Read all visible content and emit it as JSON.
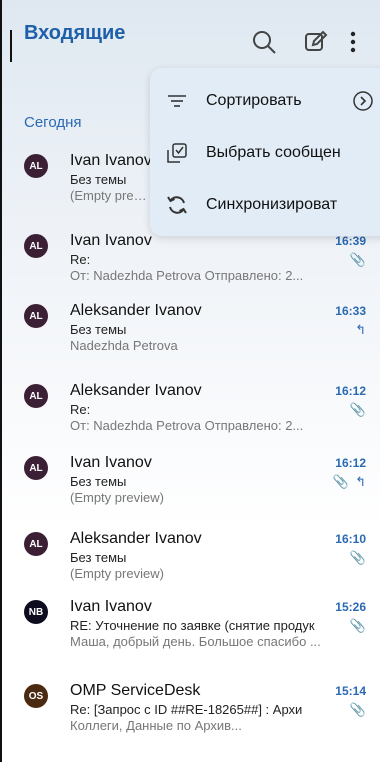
{
  "header": {
    "title": "Входящие",
    "icons": [
      "search-icon",
      "compose-icon",
      "more-icon"
    ]
  },
  "section": "Сегодня",
  "menu": [
    {
      "label": "Сортировать",
      "icon": "sort-icon",
      "has_chevron": true
    },
    {
      "label": "Выбрать сообщен",
      "icon": "select-icon",
      "has_chevron": false
    },
    {
      "label": "Синхронизироват",
      "icon": "sync-icon",
      "has_chevron": false
    }
  ],
  "messages": [
    {
      "avatar": "AL",
      "avatar_color": "#3a1f35",
      "sender": "Ivan Ivanov",
      "subject": "Без темы",
      "preview": "(Empty preview)",
      "time": "",
      "flags": []
    },
    {
      "avatar": "AL",
      "avatar_color": "#3a1f35",
      "sender": "Ivan Ivanov",
      "subject": "Re:",
      "preview": "От: Nadezhda Petrova Отправлено: 2...",
      "time": "16:39",
      "flags": [
        "attachment"
      ]
    },
    {
      "avatar": "AL",
      "avatar_color": "#3a1f35",
      "sender": "Aleksander Ivanov",
      "subject": "Без темы",
      "preview": "Nadezhda Petrova",
      "time": "16:33",
      "flags": [
        "reply"
      ]
    },
    {
      "avatar": "AL",
      "avatar_color": "#3a1f35",
      "sender": "Aleksander Ivanov",
      "subject": "Re:",
      "preview": "От: Nadezhda Petrova Отправлено: 2...",
      "time": "16:12",
      "flags": [
        "attachment"
      ]
    },
    {
      "avatar": "AL",
      "avatar_color": "#3a1f35",
      "sender": "Ivan Ivanov",
      "subject": "Без темы",
      "preview": "(Empty preview)",
      "time": "16:12",
      "flags": [
        "attachment",
        "reply"
      ]
    },
    {
      "avatar": "AL",
      "avatar_color": "#3a1f35",
      "sender": "Aleksander Ivanov",
      "subject": "Без темы",
      "preview": "(Empty preview)",
      "time": "16:10",
      "flags": [
        "attachment"
      ]
    },
    {
      "avatar": "NB",
      "avatar_color": "#0d0d1f",
      "sender": "Ivan Ivanov",
      "subject": "RE: Уточнение по заявке (снятие продук",
      "preview": "Маша, добрый день. Большое спасибо ...",
      "time": "15:26",
      "flags": [
        "attachment"
      ]
    },
    {
      "avatar": "OS",
      "avatar_color": "#4a2a10",
      "sender": "OMP ServiceDesk",
      "subject": "Re: [Запрос с ID ##RE-18265##] : Архи",
      "preview": "Коллеги, Данные по Архив...",
      "time": "15:14",
      "flags": [
        "attachment"
      ]
    }
  ]
}
